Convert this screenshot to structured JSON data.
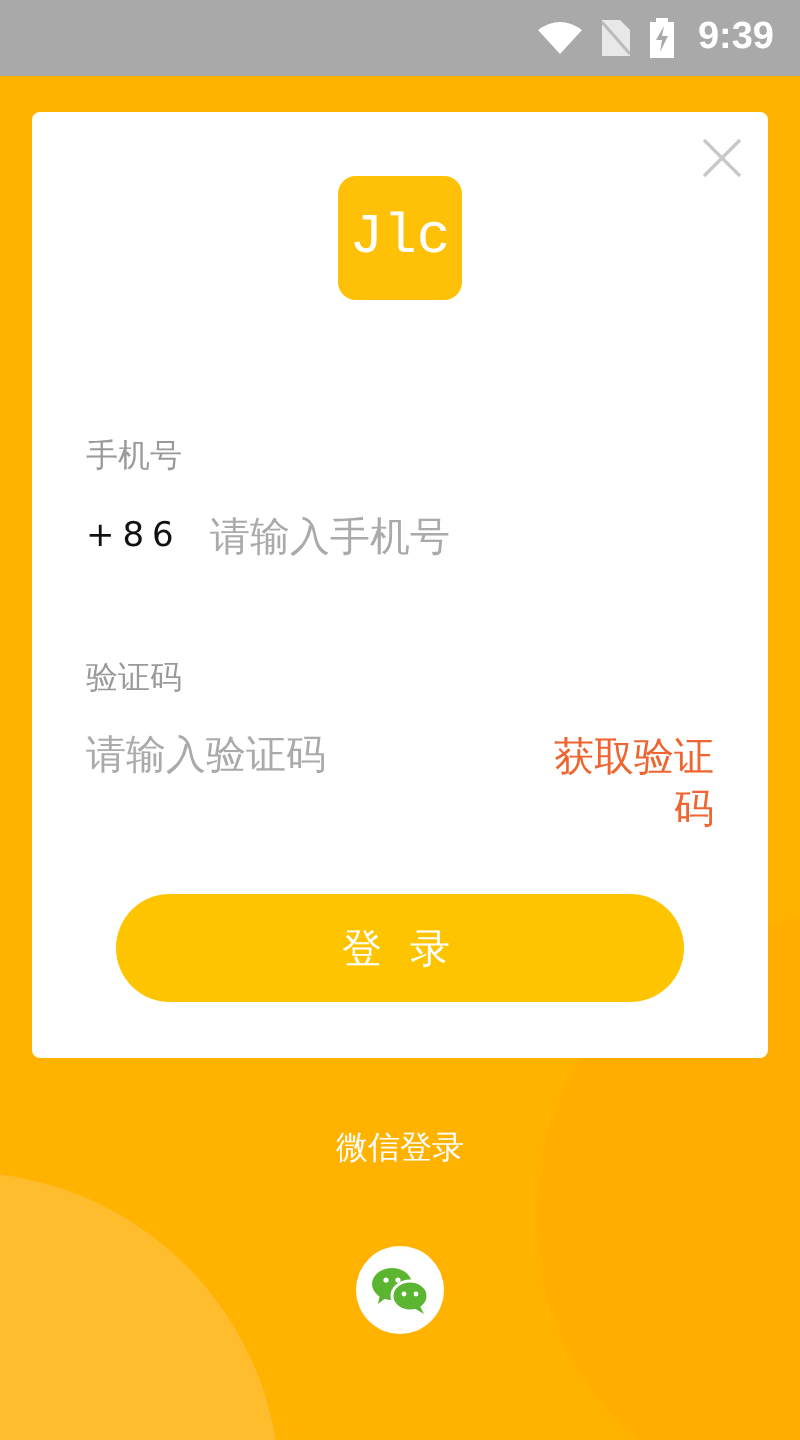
{
  "status_bar": {
    "time": "9:39"
  },
  "logo": {
    "text": "Jlc"
  },
  "phone": {
    "label": "手机号",
    "prefix": "+86",
    "placeholder": "请输入手机号"
  },
  "code": {
    "label": "验证码",
    "placeholder": "请输入验证码",
    "get_code": "获取验证码"
  },
  "login_button": "登 录",
  "wechat": {
    "label": "微信登录"
  }
}
